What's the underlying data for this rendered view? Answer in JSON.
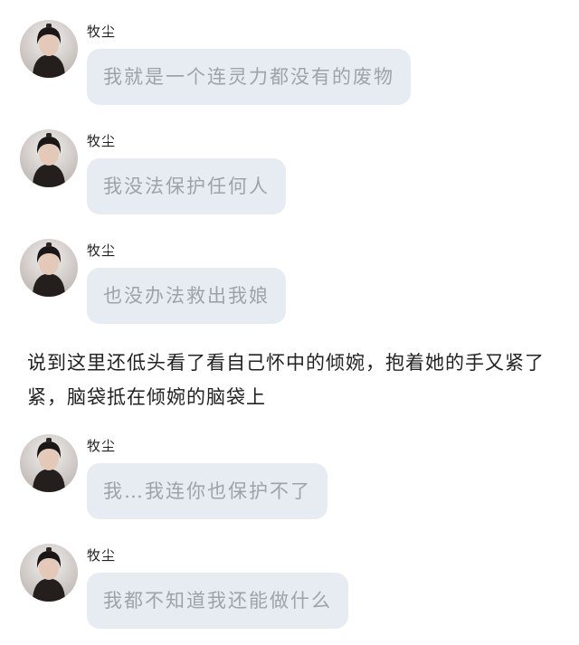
{
  "sender_name": "牧尘",
  "messages": [
    {
      "text": "我就是一个连灵力都没有的废物"
    },
    {
      "text": "我没法保护任何人"
    },
    {
      "text": "也没办法救出我娘"
    }
  ],
  "narration": "说到这里还低头看了看自己怀中的倾婉，抱着她的手又紧了紧，脑袋抵在倾婉的脑袋上",
  "messages_after": [
    {
      "text": "我…我连你也保护不了"
    },
    {
      "text": "我都不知道我还能做什么"
    }
  ],
  "colors": {
    "bubble": "#e7ebf2",
    "bubble_text": "#9ea3ab",
    "narration_text": "#222222"
  }
}
